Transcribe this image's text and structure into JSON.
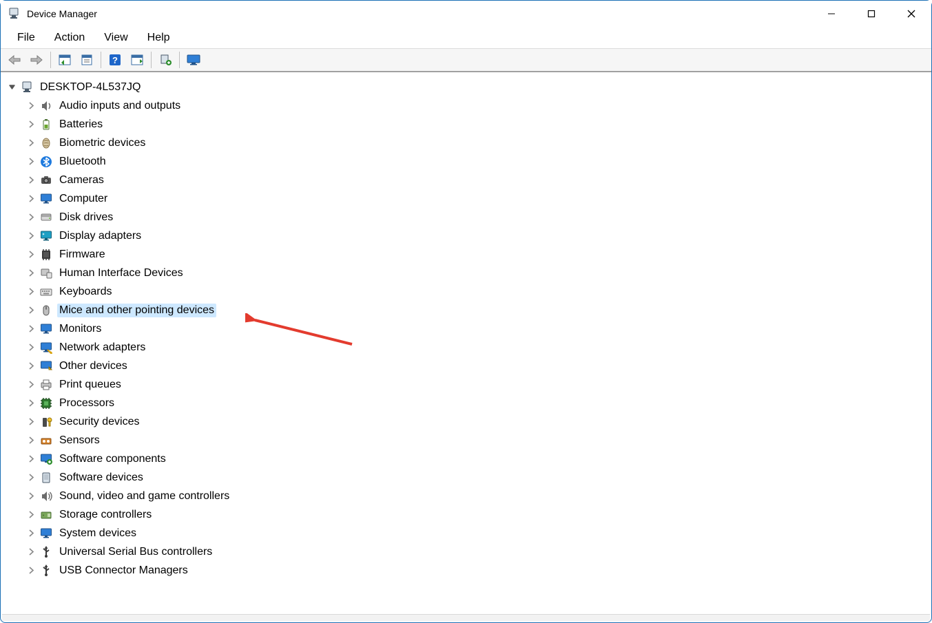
{
  "titlebar": {
    "title": "Device Manager"
  },
  "menubar": {
    "items": [
      "File",
      "Action",
      "View",
      "Help"
    ]
  },
  "toolbar": {
    "buttons": [
      {
        "name": "back",
        "disabled": true
      },
      {
        "name": "forward",
        "disabled": true
      },
      {
        "sep": true
      },
      {
        "name": "show-hide-console-tree"
      },
      {
        "name": "properties"
      },
      {
        "sep": true
      },
      {
        "name": "help"
      },
      {
        "name": "scan-hardware"
      },
      {
        "sep": true
      },
      {
        "name": "add-legacy-hardware"
      },
      {
        "sep": true
      },
      {
        "name": "monitor-view"
      }
    ]
  },
  "tree": {
    "root": {
      "label": "DESKTOP-4L537JQ",
      "icon": "computer-root-icon",
      "expanded": true
    },
    "items": [
      {
        "label": "Audio inputs and outputs",
        "icon": "audio-icon"
      },
      {
        "label": "Batteries",
        "icon": "battery-icon"
      },
      {
        "label": "Biometric devices",
        "icon": "biometric-icon"
      },
      {
        "label": "Bluetooth",
        "icon": "bluetooth-icon"
      },
      {
        "label": "Cameras",
        "icon": "camera-icon"
      },
      {
        "label": "Computer",
        "icon": "monitor-icon"
      },
      {
        "label": "Disk drives",
        "icon": "disk-icon"
      },
      {
        "label": "Display adapters",
        "icon": "display-adapter-icon"
      },
      {
        "label": "Firmware",
        "icon": "firmware-icon"
      },
      {
        "label": "Human Interface Devices",
        "icon": "hid-icon"
      },
      {
        "label": "Keyboards",
        "icon": "keyboard-icon"
      },
      {
        "label": "Mice and other pointing devices",
        "icon": "mouse-icon",
        "selected": true
      },
      {
        "label": "Monitors",
        "icon": "monitor-icon"
      },
      {
        "label": "Network adapters",
        "icon": "network-icon"
      },
      {
        "label": "Other devices",
        "icon": "other-icon"
      },
      {
        "label": "Print queues",
        "icon": "printer-icon"
      },
      {
        "label": "Processors",
        "icon": "cpu-icon"
      },
      {
        "label": "Security devices",
        "icon": "security-icon"
      },
      {
        "label": "Sensors",
        "icon": "sensor-icon"
      },
      {
        "label": "Software components",
        "icon": "software-component-icon"
      },
      {
        "label": "Software devices",
        "icon": "software-device-icon"
      },
      {
        "label": "Sound, video and game controllers",
        "icon": "sound-icon"
      },
      {
        "label": "Storage controllers",
        "icon": "storage-icon"
      },
      {
        "label": "System devices",
        "icon": "system-icon"
      },
      {
        "label": "Universal Serial Bus controllers",
        "icon": "usb-icon"
      },
      {
        "label": "USB Connector Managers",
        "icon": "usb-icon"
      }
    ]
  },
  "annotation": {
    "arrow_color": "#e33b2e"
  }
}
